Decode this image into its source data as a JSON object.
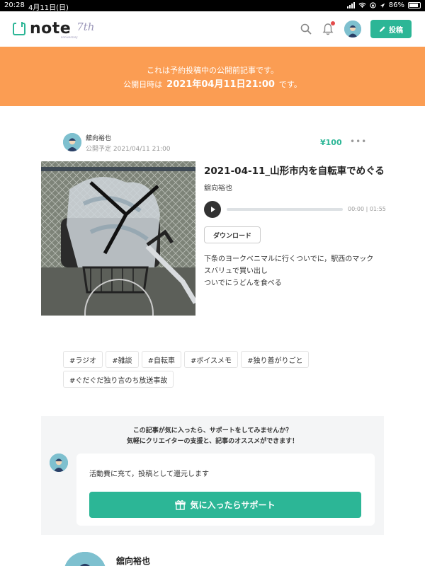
{
  "status_bar": {
    "time": "20:28",
    "date": "4月11日(日)",
    "battery": "86%"
  },
  "header": {
    "logo_text": "note",
    "logo_anniversary": "7th",
    "logo_anniversary_sub": "anniversary",
    "post_button_label": "投稿",
    "accent_color": "#2cb696",
    "notification_dot_color": "#e34b4b"
  },
  "banner": {
    "line1": "これは予約投稿中の公開前記事です。",
    "line2_prefix": "公開日時は",
    "line2_datetime": "2021年04月11日21:00",
    "line2_suffix": "です。",
    "background_color": "#fb9d53"
  },
  "article_meta": {
    "author_name": "舘向裕也",
    "scheduled_label": "公開予定 2021/04/11 21:00",
    "price": "¥100",
    "more_label": "•••"
  },
  "article": {
    "title": "2021-04-11_山形市内を自転車でめぐる",
    "author_name": "舘向裕也",
    "audio_time": "00:00 | 01:55",
    "audio_progress": 0,
    "download_label": "ダウンロード",
    "description_lines": [
      "下条のヨークベニマルに行くついでに，駅西のマック",
      "スバリュで買い出し",
      "ついでにうどんを食べる"
    ]
  },
  "hashtags": [
    "#ラジオ",
    "#雑談",
    "#自転車",
    "#ボイスメモ",
    "#独り善がりごと",
    "#ぐだぐだ独り言のち放送事故"
  ],
  "support": {
    "line1": "この記事が気に入ったら、サポートをしてみませんか？",
    "line2": "気軽にクリエイターの支援と、記事のオススメができます！",
    "message": "活動費に充て，投稿として還元します",
    "button_label": "気に入ったらサポート"
  },
  "footer_author": {
    "name": "舘向裕也"
  }
}
